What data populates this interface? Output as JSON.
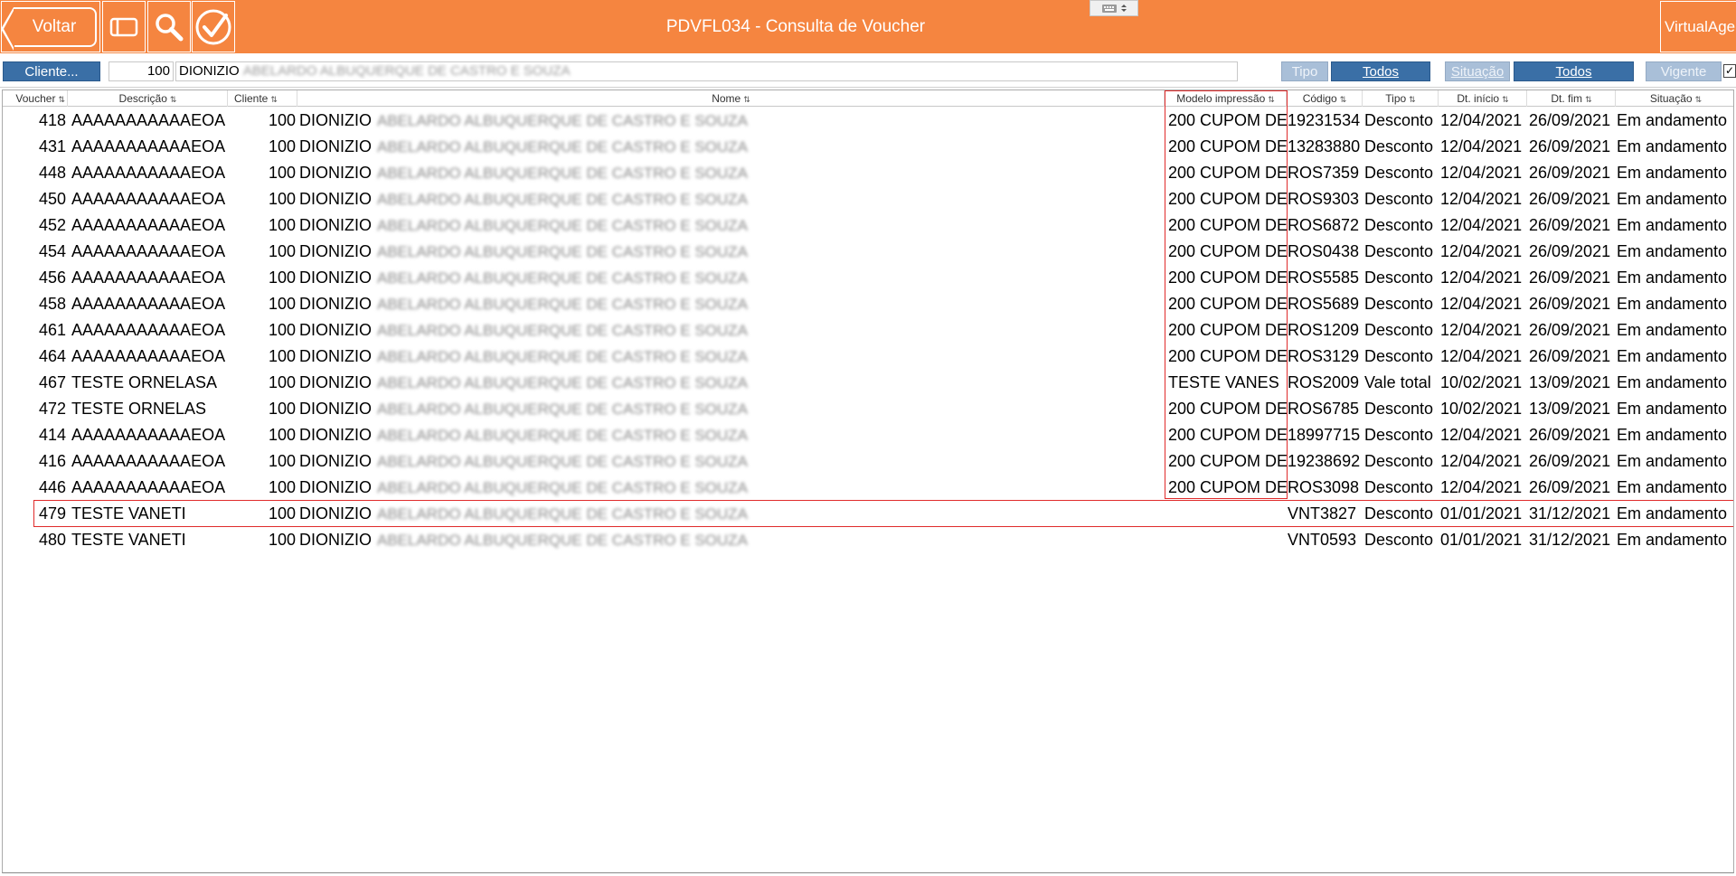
{
  "header": {
    "back_label": "Voltar",
    "title": "PDVFL034 - Consulta de Voucher",
    "app_button_label": "VirtualAge"
  },
  "filters": {
    "cliente_button": "Cliente...",
    "cliente_code": "100",
    "cliente_name_visible": "DIONIZIO",
    "cliente_name_redacted": "ABELARDO ALBUQUERQUE DE CASTRO E SOUZA",
    "tipo_label": "Tipo",
    "tipo_value": "Todos",
    "situacao_label": "Situação",
    "situacao_value": "Todos",
    "vigente_label": "Vigente",
    "vigente_checked": true
  },
  "table": {
    "columns": [
      "Voucher",
      "Descrição",
      "Cliente",
      "Nome",
      "Modelo impressão",
      "Código",
      "Tipo",
      "Dt. início",
      "Dt. fim",
      "Situação"
    ],
    "rows": [
      {
        "voucher": "418",
        "descricao": "AAAAAAAAAAAEOA",
        "cliente": "100",
        "nome": "DIONIZIO",
        "nome_redacted": "ABELARDO ALBUQUERQUE DE CASTRO E SOUZA",
        "modelo": "200 CUPOM DE",
        "codigo": "19231534",
        "tipo": "Desconto",
        "dt_inicio": "12/04/2021",
        "dt_fim": "26/09/2021",
        "situacao": "Em andamento"
      },
      {
        "voucher": "431",
        "descricao": "AAAAAAAAAAAEOA",
        "cliente": "100",
        "nome": "DIONIZIO",
        "nome_redacted": "ABELARDO ALBUQUERQUE DE CASTRO E SOUZA",
        "modelo": "200 CUPOM DE",
        "codigo": "13283880",
        "tipo": "Desconto",
        "dt_inicio": "12/04/2021",
        "dt_fim": "26/09/2021",
        "situacao": "Em andamento"
      },
      {
        "voucher": "448",
        "descricao": "AAAAAAAAAAAEOA",
        "cliente": "100",
        "nome": "DIONIZIO",
        "nome_redacted": "ABELARDO ALBUQUERQUE DE CASTRO E SOUZA",
        "modelo": "200 CUPOM DE",
        "codigo": "ROS7359",
        "tipo": "Desconto",
        "dt_inicio": "12/04/2021",
        "dt_fim": "26/09/2021",
        "situacao": "Em andamento"
      },
      {
        "voucher": "450",
        "descricao": "AAAAAAAAAAAEOA",
        "cliente": "100",
        "nome": "DIONIZIO",
        "nome_redacted": "ABELARDO ALBUQUERQUE DE CASTRO E SOUZA",
        "modelo": "200 CUPOM DE",
        "codigo": "ROS9303",
        "tipo": "Desconto",
        "dt_inicio": "12/04/2021",
        "dt_fim": "26/09/2021",
        "situacao": "Em andamento"
      },
      {
        "voucher": "452",
        "descricao": "AAAAAAAAAAAEOA",
        "cliente": "100",
        "nome": "DIONIZIO",
        "nome_redacted": "ABELARDO ALBUQUERQUE DE CASTRO E SOUZA",
        "modelo": "200 CUPOM DE",
        "codigo": "ROS6872",
        "tipo": "Desconto",
        "dt_inicio": "12/04/2021",
        "dt_fim": "26/09/2021",
        "situacao": "Em andamento"
      },
      {
        "voucher": "454",
        "descricao": "AAAAAAAAAAAEOA",
        "cliente": "100",
        "nome": "DIONIZIO",
        "nome_redacted": "ABELARDO ALBUQUERQUE DE CASTRO E SOUZA",
        "modelo": "200 CUPOM DE",
        "codigo": "ROS0438",
        "tipo": "Desconto",
        "dt_inicio": "12/04/2021",
        "dt_fim": "26/09/2021",
        "situacao": "Em andamento"
      },
      {
        "voucher": "456",
        "descricao": "AAAAAAAAAAAEOA",
        "cliente": "100",
        "nome": "DIONIZIO",
        "nome_redacted": "ABELARDO ALBUQUERQUE DE CASTRO E SOUZA",
        "modelo": "200 CUPOM DE",
        "codigo": "ROS5585",
        "tipo": "Desconto",
        "dt_inicio": "12/04/2021",
        "dt_fim": "26/09/2021",
        "situacao": "Em andamento"
      },
      {
        "voucher": "458",
        "descricao": "AAAAAAAAAAAEOA",
        "cliente": "100",
        "nome": "DIONIZIO",
        "nome_redacted": "ABELARDO ALBUQUERQUE DE CASTRO E SOUZA",
        "modelo": "200 CUPOM DE",
        "codigo": "ROS5689",
        "tipo": "Desconto",
        "dt_inicio": "12/04/2021",
        "dt_fim": "26/09/2021",
        "situacao": "Em andamento"
      },
      {
        "voucher": "461",
        "descricao": "AAAAAAAAAAAEOA",
        "cliente": "100",
        "nome": "DIONIZIO",
        "nome_redacted": "ABELARDO ALBUQUERQUE DE CASTRO E SOUZA",
        "modelo": "200 CUPOM DE",
        "codigo": "ROS1209",
        "tipo": "Desconto",
        "dt_inicio": "12/04/2021",
        "dt_fim": "26/09/2021",
        "situacao": "Em andamento"
      },
      {
        "voucher": "464",
        "descricao": "AAAAAAAAAAAEOA",
        "cliente": "100",
        "nome": "DIONIZIO",
        "nome_redacted": "ABELARDO ALBUQUERQUE DE CASTRO E SOUZA",
        "modelo": "200 CUPOM DE",
        "codigo": "ROS3129",
        "tipo": "Desconto",
        "dt_inicio": "12/04/2021",
        "dt_fim": "26/09/2021",
        "situacao": "Em andamento"
      },
      {
        "voucher": "467",
        "descricao": "TESTE ORNELASA",
        "cliente": "100",
        "nome": "DIONIZIO",
        "nome_redacted": "ABELARDO ALBUQUERQUE DE CASTRO E SOUZA",
        "modelo": "TESTE VANES",
        "codigo": "ROS2009",
        "tipo": "Vale total",
        "dt_inicio": "10/02/2021",
        "dt_fim": "13/09/2021",
        "situacao": "Em andamento"
      },
      {
        "voucher": "472",
        "descricao": "TESTE ORNELAS",
        "cliente": "100",
        "nome": "DIONIZIO",
        "nome_redacted": "ABELARDO ALBUQUERQUE DE CASTRO E SOUZA",
        "modelo": "200 CUPOM DE",
        "codigo": "ROS6785",
        "tipo": "Desconto",
        "dt_inicio": "10/02/2021",
        "dt_fim": "13/09/2021",
        "situacao": "Em andamento"
      },
      {
        "voucher": "414",
        "descricao": "AAAAAAAAAAAEOA",
        "cliente": "100",
        "nome": "DIONIZIO",
        "nome_redacted": "ABELARDO ALBUQUERQUE DE CASTRO E SOUZA",
        "modelo": "200 CUPOM DE",
        "codigo": "18997715",
        "tipo": "Desconto",
        "dt_inicio": "12/04/2021",
        "dt_fim": "26/09/2021",
        "situacao": "Em andamento"
      },
      {
        "voucher": "416",
        "descricao": "AAAAAAAAAAAEOA",
        "cliente": "100",
        "nome": "DIONIZIO",
        "nome_redacted": "ABELARDO ALBUQUERQUE DE CASTRO E SOUZA",
        "modelo": "200 CUPOM DE",
        "codigo": "19238692",
        "tipo": "Desconto",
        "dt_inicio": "12/04/2021",
        "dt_fim": "26/09/2021",
        "situacao": "Em andamento"
      },
      {
        "voucher": "446",
        "descricao": "AAAAAAAAAAAEOA",
        "cliente": "100",
        "nome": "DIONIZIO",
        "nome_redacted": "ABELARDO ALBUQUERQUE DE CASTRO E SOUZA",
        "modelo": "200 CUPOM DE",
        "codigo": "ROS3098",
        "tipo": "Desconto",
        "dt_inicio": "12/04/2021",
        "dt_fim": "26/09/2021",
        "situacao": "Em andamento"
      },
      {
        "voucher": "479",
        "descricao": "TESTE VANETI",
        "cliente": "100",
        "nome": "DIONIZIO",
        "nome_redacted": "ABELARDO ALBUQUERQUE DE CASTRO E SOUZA",
        "modelo": "",
        "codigo": "VNT3827",
        "tipo": "Desconto",
        "dt_inicio": "01/01/2021",
        "dt_fim": "31/12/2021",
        "situacao": "Em andamento"
      },
      {
        "voucher": "480",
        "descricao": "TESTE VANETI",
        "cliente": "100",
        "nome": "DIONIZIO",
        "nome_redacted": "ABELARDO ALBUQUERQUE DE CASTRO E SOUZA",
        "modelo": "",
        "codigo": "VNT0593",
        "tipo": "Desconto",
        "dt_inicio": "01/01/2021",
        "dt_fim": "31/12/2021",
        "situacao": "Em andamento"
      }
    ]
  },
  "icons": {
    "back": "arrow-left-icon",
    "panel": "panel-icon",
    "search": "search-icon",
    "confirm": "check-circle-icon",
    "keyboard": "keyboard-icon",
    "sort": "sort-icon"
  },
  "colors": {
    "header_bg": "#f58540",
    "filter_button": "#3a6fa6",
    "filter_button_disabled": "#a9bfd8",
    "highlight": "#e02b2b"
  }
}
